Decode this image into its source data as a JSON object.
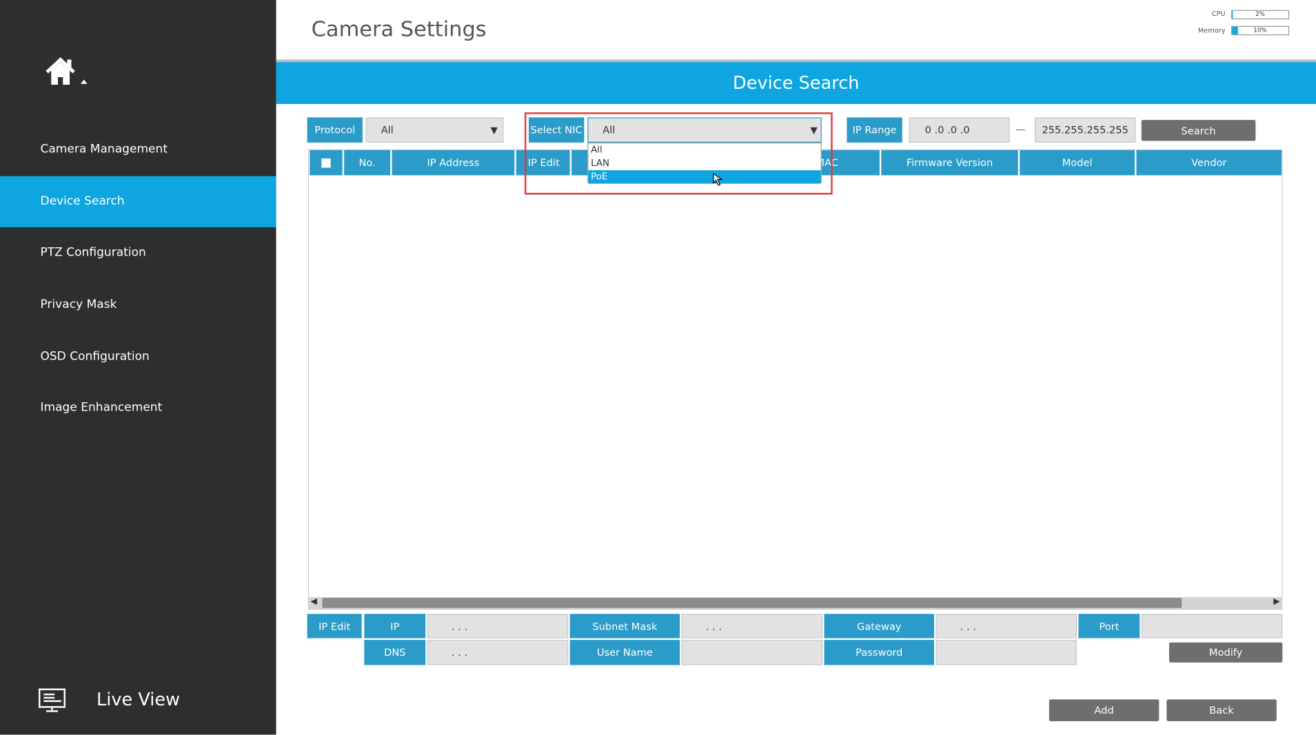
{
  "header": {
    "title": "Camera Settings",
    "cpu_label": "CPU",
    "cpu_value": "2%",
    "cpu_percent": 2,
    "memory_label": "Memory",
    "memory_value": "10%",
    "memory_percent": 10
  },
  "sidebar": {
    "items": [
      {
        "label": "Camera Management",
        "active": false
      },
      {
        "label": "Device Search",
        "active": true
      },
      {
        "label": "PTZ Configuration",
        "active": false
      },
      {
        "label": "Privacy Mask",
        "active": false
      },
      {
        "label": "OSD Configuration",
        "active": false
      },
      {
        "label": "Image Enhancement",
        "active": false
      }
    ],
    "live_view": "Live View"
  },
  "panel": {
    "title": "Device Search"
  },
  "filters": {
    "protocol_label": "Protocol",
    "protocol_value": "All",
    "nic_label": "Select NIC",
    "nic_value": "All",
    "nic_options": [
      "All",
      "LAN",
      "PoE"
    ],
    "nic_highlighted": "PoE",
    "ip_range_label": "IP Range",
    "ip_start": "0 .0 .0 .0",
    "ip_separator": "—",
    "ip_end": "255.255.255.255",
    "search_button": "Search"
  },
  "table": {
    "columns": [
      "No.",
      "IP Address",
      "IP Edit",
      "",
      "MAC",
      "Firmware Version",
      "Model",
      "Vendor"
    ],
    "rows": []
  },
  "edit": {
    "ip_edit": "IP Edit",
    "ip": "IP",
    "ip_value": ". . .",
    "subnet_mask": "Subnet Mask",
    "subnet_value": ". . .",
    "gateway": "Gateway",
    "gateway_value": ". . .",
    "port": "Port",
    "port_value": "",
    "dns": "DNS",
    "dns_value": ". . .",
    "user_name": "User Name",
    "user_name_value": "",
    "password": "Password",
    "password_value": "",
    "modify_button": "Modify"
  },
  "footer": {
    "add_button": "Add",
    "back_button": "Back"
  },
  "colors": {
    "accent": "#0ea5e0",
    "label_blue": "#2b9bc9",
    "sidebar": "#2e2e2e",
    "highlight_box": "#e53935"
  }
}
